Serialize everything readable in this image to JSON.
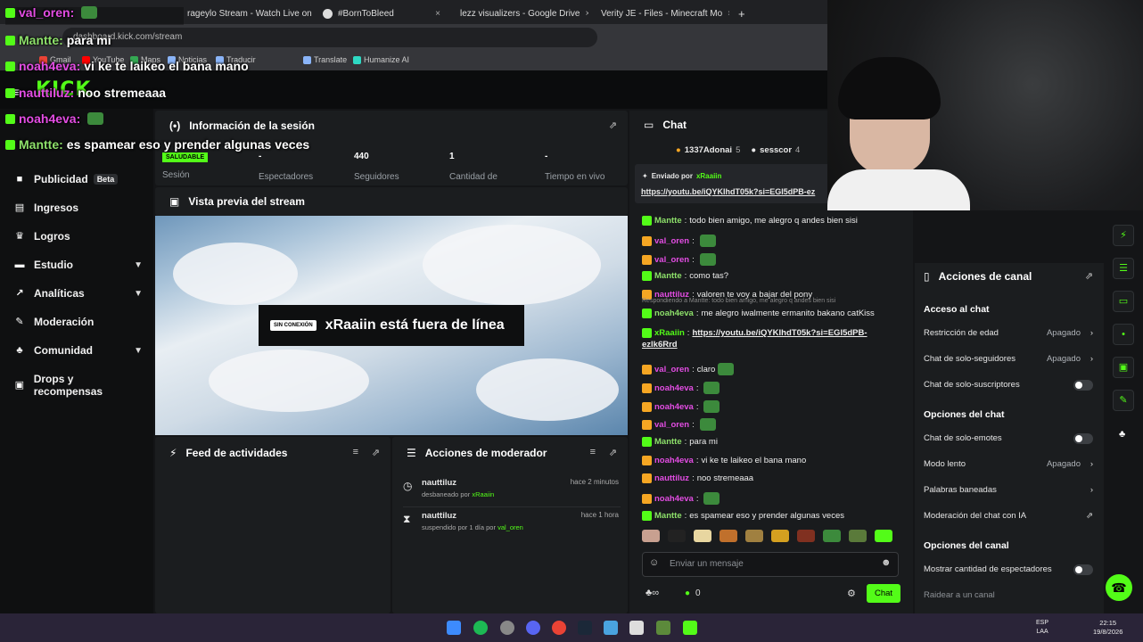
{
  "browser": {
    "tabs": [
      {
        "label": "rageylo Stream - Watch Live on",
        "icon_color": "#53fc18"
      },
      {
        "label": "#BornToBleed",
        "icon_color": "#e0e0e0"
      },
      {
        "label": "lezz visualizers - Google Drive",
        "icon_color": "#fbbc04"
      },
      {
        "label": "Verity JE - Files - Minecraft Mo",
        "icon_color": "#e6533c"
      }
    ],
    "new_tab": "+",
    "close_glyph": "×",
    "url": "dashboard.kick.com/stream",
    "bookmarks": [
      "Gmail",
      "YouTube",
      "Maps",
      "Noticias",
      "Traducir",
      "Translate",
      "Humanize AI"
    ]
  },
  "header": {
    "logo": "KICK"
  },
  "sidebar": {
    "items": [
      {
        "label": "Publicidad",
        "badge": "Beta",
        "icon": "megaphone-icon",
        "chevron": false
      },
      {
        "label": "Ingresos",
        "icon": "wallet-icon",
        "chevron": false
      },
      {
        "label": "Logros",
        "icon": "trophy-icon",
        "chevron": false
      },
      {
        "label": "Estudio",
        "icon": "studio-icon",
        "chevron": true
      },
      {
        "label": "Analíticas",
        "icon": "chart-icon",
        "chevron": true
      },
      {
        "label": "Moderación",
        "icon": "wrench-icon",
        "chevron": false
      },
      {
        "label": "Comunidad",
        "icon": "community-icon",
        "chevron": true
      },
      {
        "label": "Drops y recompensas",
        "icon": "gift-icon",
        "chevron": false
      }
    ]
  },
  "session": {
    "title": "Información de la sesión",
    "status_badge": "SALUDABLE",
    "status_label": "Sesión",
    "stats": [
      {
        "value": "-",
        "label": "Espectadores"
      },
      {
        "value": "440",
        "label": "Seguidores"
      },
      {
        "value": "1",
        "label": "Cantidad de"
      },
      {
        "value": "-",
        "label": "Tiempo en vivo"
      }
    ]
  },
  "preview": {
    "title": "Vista previa del stream",
    "offline_tag": "SIN CONEXIÓN",
    "offline_text": "xRaaiin está fuera de línea"
  },
  "activity": {
    "title": "Feed de actividades"
  },
  "mod_actions": {
    "title": "Acciones de moderador",
    "items": [
      {
        "user": "nauttiluz",
        "action": "desbaneado por",
        "by": "xRaaiin",
        "time": "hace 2 minutos",
        "icon": "clock-icon"
      },
      {
        "user": "nauttiluz",
        "action": "suspendido por 1 día por",
        "by": "val_oren",
        "time": "hace 1 hora",
        "icon": "hourglass-icon"
      }
    ]
  },
  "chat": {
    "title": "Chat",
    "top_supporters": [
      {
        "name": "1337Adonai",
        "count": "5"
      },
      {
        "name": "sesscor",
        "count": "4"
      }
    ],
    "pinned": {
      "label": "Enviado por",
      "user": "xRaaiin",
      "link": "https://youtu.be/iQYKIhdT05k?si=EGI5dPB-ez"
    },
    "messages": [
      {
        "user": "Mantte",
        "text": "todo bien amigo, me alegro q andes bien sisi",
        "color": "#8de06a"
      },
      {
        "user": "val_oren",
        "text": "",
        "color": "#e34de3"
      },
      {
        "user": "val_oren",
        "text": "",
        "color": "#e34de3"
      },
      {
        "user": "Mantte",
        "text": "como tas?",
        "color": "#8de06a"
      },
      {
        "user": "nauttiluz",
        "text": "valoren te voy a bajar del pony",
        "color": "#e34de3"
      },
      {
        "user": "noah4eva",
        "text": "me alegro iwalmente ermanito bakano catKiss",
        "color": "#8de06a",
        "reply": "Respondiendo a Mantte: todo bien amigo, me alegro q andes bien sisi"
      },
      {
        "user": "xRaaiin",
        "text": "https://youtu.be/iQYKIhdT05k?si=EGI5dPB-",
        "text2": "ezlk6Rrd",
        "color": "#53fc18"
      },
      {
        "user": "val_oren",
        "text": "claro",
        "color": "#e34de3"
      },
      {
        "user": "noah4eva",
        "text": "",
        "color": "#e34de3"
      },
      {
        "user": "noah4eva",
        "text": "",
        "color": "#e34de3"
      },
      {
        "user": "val_oren",
        "text": "",
        "color": "#e34de3"
      },
      {
        "user": "Mantte",
        "text": "para mi",
        "color": "#8de06a"
      },
      {
        "user": "noah4eva",
        "text": "vi ke te laikeo el bana mano",
        "color": "#e34de3"
      },
      {
        "user": "nauttiluz",
        "text": "noo stremeaaa",
        "color": "#e34de3"
      },
      {
        "user": "noah4eva",
        "text": "",
        "color": "#e34de3"
      },
      {
        "user": "Mantte",
        "text": "es spamear eso y prender algunas veces",
        "color": "#8de06a"
      }
    ],
    "input_placeholder": "Enviar un mensaje",
    "footer_count": "0",
    "send_label": "Chat"
  },
  "channel_actions": {
    "title": "Acciones de canal",
    "sections": [
      {
        "heading": "Acceso al chat",
        "rows": [
          {
            "label": "Restricción de edad",
            "state": "Apagado",
            "type": "chevron"
          },
          {
            "label": "Chat de solo-seguidores",
            "state": "Apagado",
            "type": "chevron"
          },
          {
            "label": "Chat de solo-suscriptores",
            "state": "",
            "type": "toggle"
          }
        ]
      },
      {
        "heading": "Opciones del chat",
        "rows": [
          {
            "label": "Chat de solo-emotes",
            "state": "",
            "type": "toggle"
          },
          {
            "label": "Modo lento",
            "state": "Apagado",
            "type": "chevron"
          },
          {
            "label": "Palabras baneadas",
            "state": "",
            "type": "chevron"
          },
          {
            "label": "Moderación del chat con IA",
            "state": "",
            "type": "external"
          }
        ]
      },
      {
        "heading": "Opciones del canal",
        "rows": [
          {
            "label": "Mostrar cantidad de espectadores",
            "state": "",
            "type": "toggle"
          },
          {
            "label": "Raidear a un canal",
            "state": "",
            "type": "none"
          }
        ]
      }
    ]
  },
  "overlay_chat": [
    {
      "user": "val_oren:",
      "text": "",
      "color": "#e34de3"
    },
    {
      "user": "Mantte:",
      "text": "para mi",
      "color": "#8de06a"
    },
    {
      "user": "noah4eva:",
      "text": "vi ke te laikeo el bana mano",
      "color": "#e34de3"
    },
    {
      "user": "nauttiluz:",
      "text": "noo stremeaaa",
      "color": "#e34de3"
    },
    {
      "user": "noah4eva:",
      "text": "",
      "color": "#e34de3"
    },
    {
      "user": "Mantte:",
      "text": "es spamear eso y prender algunas veces",
      "color": "#8de06a"
    }
  ],
  "taskbar": {
    "lang": "ESP",
    "lang2": "LAA",
    "time": "22:15",
    "date": "19/8/2026"
  },
  "colors": {
    "accent": "#53fc18"
  }
}
